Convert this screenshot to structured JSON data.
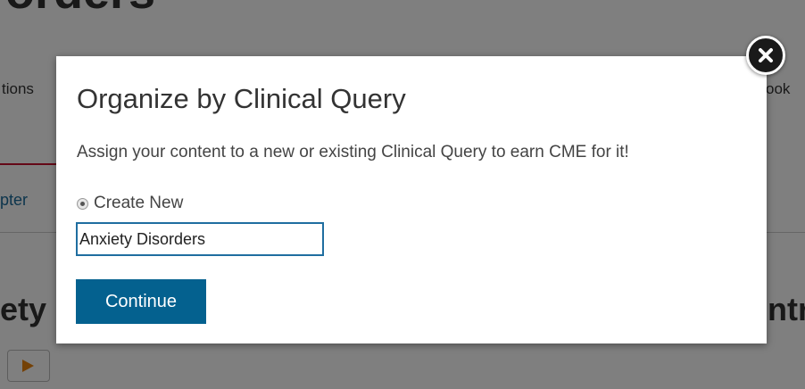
{
  "background": {
    "title_fragment": "orders",
    "nav_left_fragment": "tions",
    "nav_right_fragment": "ook",
    "chapter_fragment": "pter",
    "heading_left_fragment": "ety",
    "heading_right_fragment": "ntr"
  },
  "modal": {
    "title": "Organize by Clinical Query",
    "description": "Assign your content to a new or existing Clinical Query to earn CME for it!",
    "radio_label": "Create New",
    "radio_selected": true,
    "input_value": "Anxiety Disorders",
    "continue_label": "Continue"
  },
  "colors": {
    "primary_button": "#04618f",
    "input_border": "#1f6ea0",
    "accent_red": "#c8102e"
  },
  "icons": {
    "close": "close-icon",
    "play": "play-icon"
  }
}
